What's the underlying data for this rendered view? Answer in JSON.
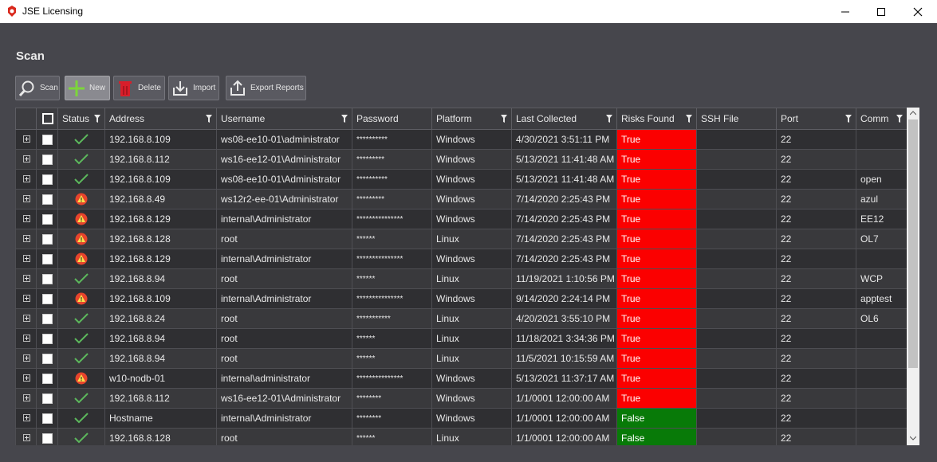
{
  "window": {
    "title": "JSE Licensing"
  },
  "section": {
    "title": "Scan"
  },
  "toolbar": {
    "scan": "Scan",
    "new": "New",
    "delete": "Delete",
    "import": "Import",
    "export": "Export Reports"
  },
  "columns": [
    "Status",
    "Address",
    "Username",
    "Password",
    "Platform",
    "Last Collected",
    "Risks Found",
    "SSH File",
    "Port",
    "Comm"
  ],
  "rows": [
    {
      "status": "ok",
      "address": "192.168.8.109",
      "username": "ws08-ee10-01\\administrator",
      "password": "**********",
      "platform": "Windows",
      "last": "4/30/2021 3:51:11 PM",
      "risk": "True",
      "ssh": "",
      "port": "22",
      "comm": ""
    },
    {
      "status": "ok",
      "address": "192.168.8.112",
      "username": "ws16-ee12-01\\Administrator",
      "password": "*********",
      "platform": "Windows",
      "last": "5/13/2021 11:41:48 AM",
      "risk": "True",
      "ssh": "",
      "port": "22",
      "comm": ""
    },
    {
      "status": "ok",
      "address": "192.168.8.109",
      "username": "ws08-ee10-01\\Administrator",
      "password": "**********",
      "platform": "Windows",
      "last": "5/13/2021 11:41:48 AM",
      "risk": "True",
      "ssh": "",
      "port": "22",
      "comm": "open"
    },
    {
      "status": "warn",
      "address": "192.168.8.49",
      "username": "ws12r2-ee-01\\Administrator",
      "password": "*********",
      "platform": "Windows",
      "last": "7/14/2020 2:25:43 PM",
      "risk": "True",
      "ssh": "",
      "port": "22",
      "comm": "azul"
    },
    {
      "status": "warn",
      "address": "192.168.8.129",
      "username": "internal\\Administrator",
      "password": "***************",
      "platform": "Windows",
      "last": "7/14/2020 2:25:43 PM",
      "risk": "True",
      "ssh": "",
      "port": "22",
      "comm": "EE12"
    },
    {
      "status": "warn",
      "address": "192.168.8.128",
      "username": "root",
      "password": "******",
      "platform": "Linux",
      "last": "7/14/2020 2:25:43 PM",
      "risk": "True",
      "ssh": "",
      "port": "22",
      "comm": "OL7"
    },
    {
      "status": "warn",
      "address": "192.168.8.129",
      "username": "internal\\Administrator",
      "password": "***************",
      "platform": "Windows",
      "last": "7/14/2020 2:25:43 PM",
      "risk": "True",
      "ssh": "",
      "port": "22",
      "comm": ""
    },
    {
      "status": "ok",
      "address": "192.168.8.94",
      "username": "root",
      "password": "******",
      "platform": "Linux",
      "last": "11/19/2021 1:10:56 PM",
      "risk": "True",
      "ssh": "",
      "port": "22",
      "comm": "WCP"
    },
    {
      "status": "warn",
      "address": "192.168.8.109",
      "username": "internal\\Administrator",
      "password": "***************",
      "platform": "Windows",
      "last": "9/14/2020 2:24:14 PM",
      "risk": "True",
      "ssh": "",
      "port": "22",
      "comm": "apptest"
    },
    {
      "status": "ok",
      "address": "192.168.8.24",
      "username": "root",
      "password": "***********",
      "platform": "Linux",
      "last": "4/20/2021 3:55:10 PM",
      "risk": "True",
      "ssh": "",
      "port": "22",
      "comm": "OL6"
    },
    {
      "status": "ok",
      "address": "192.168.8.94",
      "username": "root",
      "password": "******",
      "platform": "Linux",
      "last": "11/18/2021 3:34:36 PM",
      "risk": "True",
      "ssh": "",
      "port": "22",
      "comm": ""
    },
    {
      "status": "ok",
      "address": "192.168.8.94",
      "username": "root",
      "password": "******",
      "platform": "Linux",
      "last": "11/5/2021 10:15:59 AM",
      "risk": "True",
      "ssh": "",
      "port": "22",
      "comm": ""
    },
    {
      "status": "warn",
      "address": "w10-nodb-01",
      "username": "internal\\administrator",
      "password": "***************",
      "platform": "Windows",
      "last": "5/13/2021 11:37:17 AM",
      "risk": "True",
      "ssh": "",
      "port": "22",
      "comm": ""
    },
    {
      "status": "ok",
      "address": "192.168.8.112",
      "username": "ws16-ee12-01\\Administrator",
      "password": "********",
      "platform": "Windows",
      "last": "1/1/0001 12:00:00 AM",
      "risk": "True",
      "ssh": "",
      "port": "22",
      "comm": ""
    },
    {
      "status": "ok",
      "address": "Hostname",
      "username": "internal\\Administrator",
      "password": "********",
      "platform": "Windows",
      "last": "1/1/0001 12:00:00 AM",
      "risk": "False",
      "ssh": "",
      "port": "22",
      "comm": ""
    },
    {
      "status": "ok",
      "address": "192.168.8.128",
      "username": "root",
      "password": "******",
      "platform": "Linux",
      "last": "1/1/0001 12:00:00 AM",
      "risk": "False",
      "ssh": "",
      "port": "22",
      "comm": ""
    }
  ],
  "colors": {
    "risk_true": "#fb0000",
    "risk_false": "#087a08",
    "ok": "#5cb85c",
    "warn": "#e8442c"
  }
}
